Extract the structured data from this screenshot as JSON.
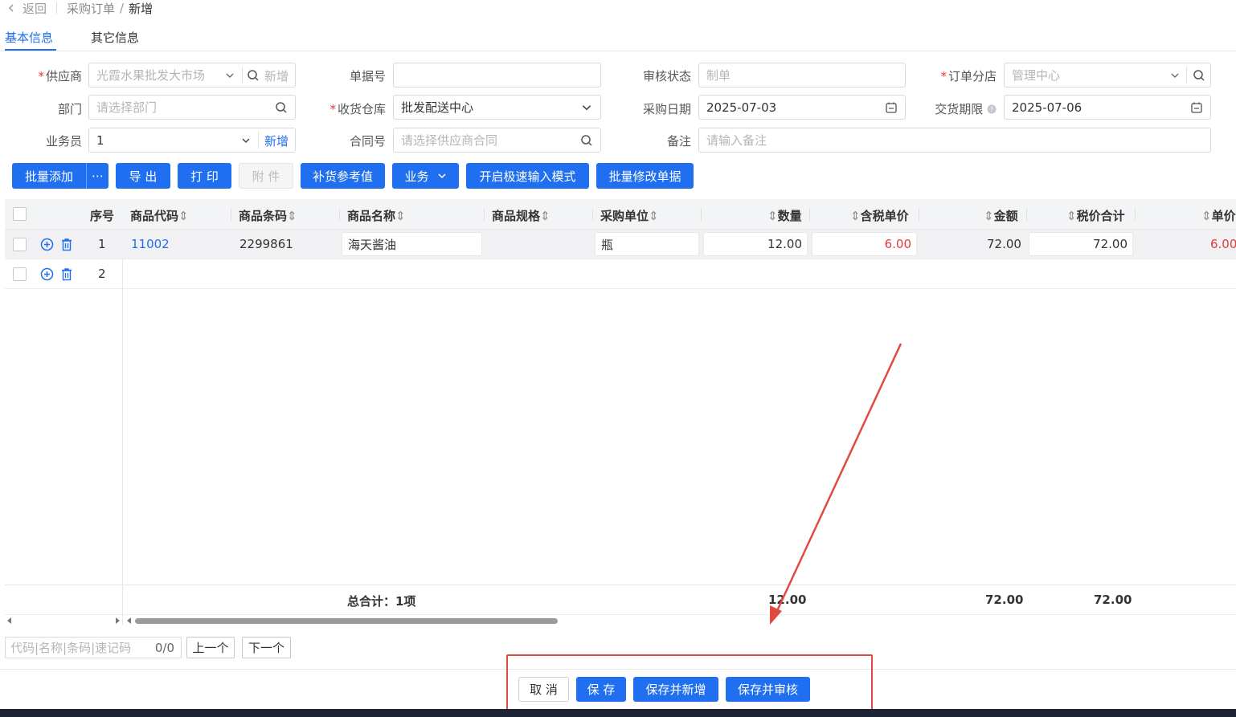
{
  "breadcrumb": {
    "back": "返回",
    "parent": "采购订单",
    "current": "新增"
  },
  "tabs": [
    {
      "label": "基本信息",
      "active": true
    },
    {
      "label": "其它信息",
      "active": false
    }
  ],
  "form": {
    "supplier_label": "供应商",
    "supplier_value": "光霞水果批发大市场",
    "supplier_add": "新增",
    "bill_no_label": "单据号",
    "bill_no_value": "",
    "audit_label": "审核状态",
    "audit_value": "制单",
    "branch_label": "订单分店",
    "branch_value": "管理中心",
    "dept_label": "部门",
    "dept_placeholder": "请选择部门",
    "warehouse_label": "收货仓库",
    "warehouse_value": "批发配送中心",
    "date_label": "采购日期",
    "date_value": "2025-07-03",
    "delivery_label": "交货期限",
    "delivery_value": "2025-07-06",
    "salesman_label": "业务员",
    "salesman_value": "1",
    "salesman_add": "新增",
    "contract_label": "合同号",
    "contract_placeholder": "请选择供应商合同",
    "remark_label": "备注",
    "remark_placeholder": "请输入备注"
  },
  "toolbar": {
    "batch_add": "批量添加",
    "export": "导 出",
    "print": "打 印",
    "attach": "附 件",
    "restock": "补货参考值",
    "business": "业务",
    "fast_input": "开启极速输入模式",
    "batch_edit": "批量修改单据"
  },
  "table": {
    "headers": {
      "seq": "序号",
      "code": "商品代码",
      "barcode": "商品条码",
      "name": "商品名称",
      "spec": "商品规格",
      "unit": "采购单位",
      "qty": "数量",
      "tax_price": "含税单价",
      "amount": "金额",
      "total": "税价合计",
      "unit_price": "单价"
    },
    "rows": [
      {
        "seq": "1",
        "code": "11002",
        "barcode": "2299861",
        "name": "海天酱油",
        "spec": "",
        "unit": "瓶",
        "qty": "12.00",
        "tax_price": "6.00",
        "amount": "72.00",
        "total": "72.00",
        "unit_price": "6.00"
      },
      {
        "seq": "2",
        "code": "",
        "barcode": "",
        "name": "",
        "spec": "",
        "unit": "",
        "qty": "",
        "tax_price": "",
        "amount": "",
        "total": "",
        "unit_price": ""
      }
    ],
    "summary": {
      "label": "总合计：1项",
      "qty": "12.00",
      "amount": "72.00",
      "total": "72.00"
    }
  },
  "finder": {
    "placeholder": "代码|名称|条码|速记码",
    "count": "0/0",
    "prev": "上一个",
    "next": "下一个"
  },
  "actions": {
    "cancel": "取 消",
    "save": "保 存",
    "save_new": "保存并新增",
    "save_audit": "保存并审核"
  },
  "colors": {
    "primary": "#1f6ff0",
    "danger": "#e23b3b",
    "annotation": "#e04a3f"
  }
}
